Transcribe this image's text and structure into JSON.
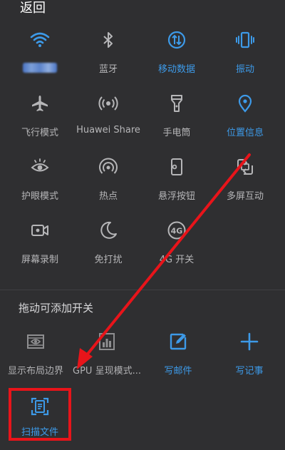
{
  "header": {
    "back_label": "返回"
  },
  "colors": {
    "background": "#2f2f31",
    "active": "#3d9ae8",
    "inactive": "#b6b6b8",
    "annotation": "#e8141a"
  },
  "toggles": [
    {
      "icon": "wifi-icon",
      "label": "",
      "active": true
    },
    {
      "icon": "bluetooth-icon",
      "label": "蓝牙",
      "active": false
    },
    {
      "icon": "mobile-data-icon",
      "label": "移动数据",
      "active": true
    },
    {
      "icon": "vibrate-icon",
      "label": "振动",
      "active": true
    },
    {
      "icon": "airplane-icon",
      "label": "飞行模式",
      "active": false
    },
    {
      "icon": "huawei-share-icon",
      "label": "Huawei Share",
      "active": false
    },
    {
      "icon": "flashlight-icon",
      "label": "手电筒",
      "active": false
    },
    {
      "icon": "location-icon",
      "label": "位置信息",
      "active": true
    },
    {
      "icon": "eye-comfort-icon",
      "label": "护眼模式",
      "active": false
    },
    {
      "icon": "hotspot-icon",
      "label": "热点",
      "active": false
    },
    {
      "icon": "floating-button-icon",
      "label": "悬浮按钮",
      "active": false
    },
    {
      "icon": "multi-screen-icon",
      "label": "多屏互动",
      "active": false
    },
    {
      "icon": "screen-record-icon",
      "label": "屏幕录制",
      "active": false
    },
    {
      "icon": "do-not-disturb-icon",
      "label": "免打扰",
      "active": false
    },
    {
      "icon": "4g-icon",
      "label": "4G 开关",
      "active": false
    }
  ],
  "drag_section": {
    "title": "拖动可添加开关",
    "items": [
      {
        "icon": "layout-bounds-icon",
        "label": "显示布局边界"
      },
      {
        "icon": "gpu-render-icon",
        "label": "GPU 呈现模式..."
      },
      {
        "icon": "compose-mail-icon",
        "label": "写邮件"
      },
      {
        "icon": "add-note-icon",
        "label": "写记事"
      }
    ],
    "highlighted": {
      "icon": "scan-document-icon",
      "label": "扫描文件"
    }
  }
}
